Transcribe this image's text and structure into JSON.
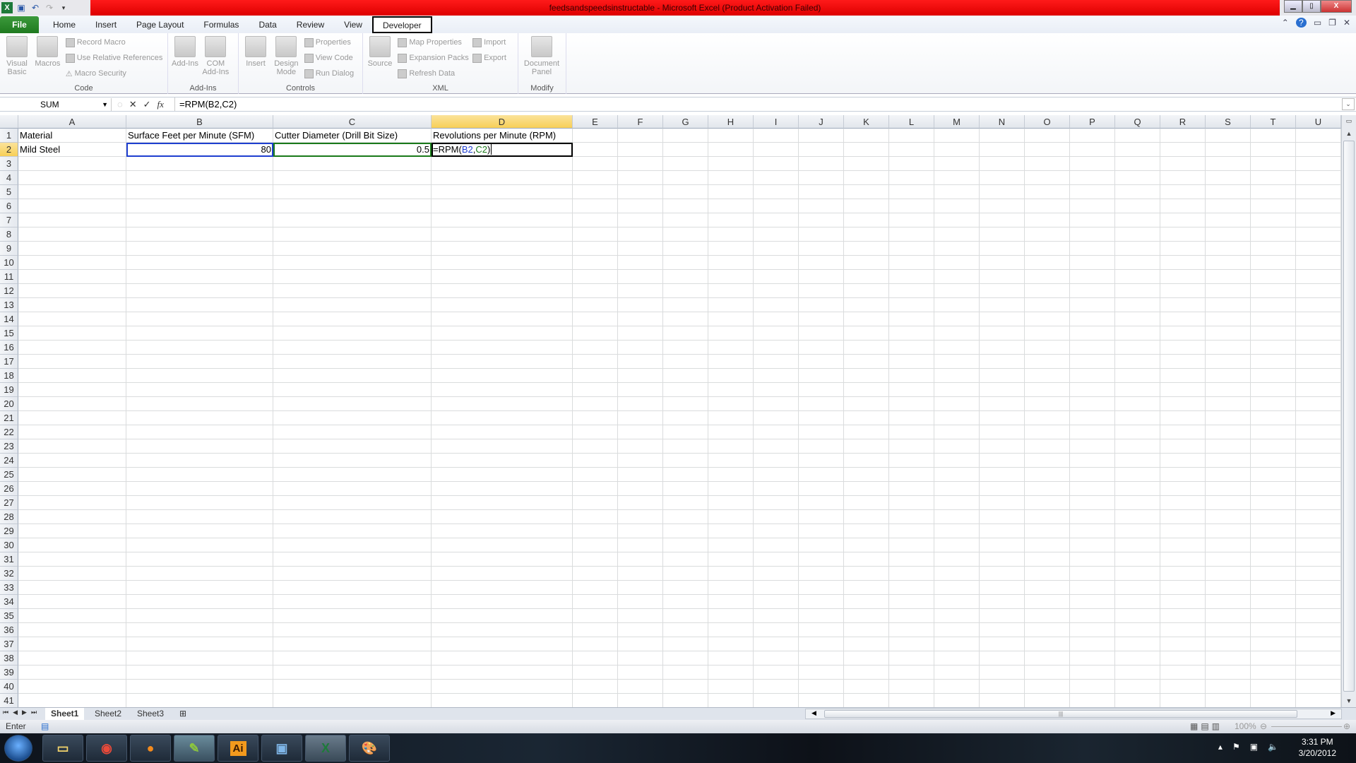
{
  "window": {
    "title": "feedsandspeedsinstructable - Microsoft Excel (Product Activation Failed)",
    "title_bar_color": "#e00000"
  },
  "ribbon_tabs": [
    "File",
    "Home",
    "Insert",
    "Page Layout",
    "Formulas",
    "Data",
    "Review",
    "View",
    "Developer"
  ],
  "active_tab": "Developer",
  "ribbon": {
    "code": {
      "label": "Code",
      "visual_basic": "Visual Basic",
      "macros": "Macros",
      "record_macro": "Record Macro",
      "use_relative": "Use Relative References",
      "macro_security": "Macro Security"
    },
    "addins": {
      "label": "Add-Ins",
      "addins": "Add-Ins",
      "com_addins": "COM Add-Ins"
    },
    "controls": {
      "label": "Controls",
      "insert": "Insert",
      "design_mode": "Design Mode",
      "properties": "Properties",
      "view_code": "View Code",
      "run_dialog": "Run Dialog"
    },
    "xml": {
      "label": "XML",
      "source": "Source",
      "map_properties": "Map Properties",
      "expansion_packs": "Expansion Packs",
      "refresh_data": "Refresh Data",
      "import": "Import",
      "export": "Export"
    },
    "modify": {
      "label": "Modify",
      "document_panel": "Document Panel"
    }
  },
  "formula_bar": {
    "name_box": "SUM",
    "formula": "=RPM(B2,C2)",
    "cancel": "✕",
    "enter": "✓",
    "fx": "fx"
  },
  "grid": {
    "columns": [
      "A",
      "B",
      "C",
      "D",
      "E",
      "F",
      "G",
      "H",
      "I",
      "J",
      "K",
      "L",
      "M",
      "N",
      "O",
      "P",
      "Q",
      "R",
      "S",
      "T",
      "U"
    ],
    "row_count": 41,
    "selected_column": "D",
    "selected_row": 2,
    "cells": {
      "A1": "Material",
      "B1": "Surface Feet per Minute (SFM)",
      "C1": "Cutter Diameter (Drill Bit Size)",
      "D1": "Revolutions per Minute (RPM)",
      "A2": "Mild Steel",
      "B2": "80",
      "C2": "0.5"
    },
    "editing_cell": {
      "ref": "D2",
      "prefix": "=RPM(",
      "arg1": "B2",
      "sep": ",",
      "arg2": "C2",
      "suffix": ")"
    },
    "ref_colors": {
      "B2": "#1f3fd0",
      "C2": "#1a7a1a"
    }
  },
  "sheets": [
    "Sheet1",
    "Sheet2",
    "Sheet3"
  ],
  "active_sheet": "Sheet1",
  "status": {
    "mode": "Enter",
    "zoom": "100%"
  },
  "taskbar": {
    "apps": [
      "file-explorer",
      "chrome",
      "firefox",
      "corel",
      "illustrator",
      "photo-viewer",
      "excel",
      "paint"
    ],
    "time": "3:31 PM",
    "date": "3/20/2012"
  }
}
